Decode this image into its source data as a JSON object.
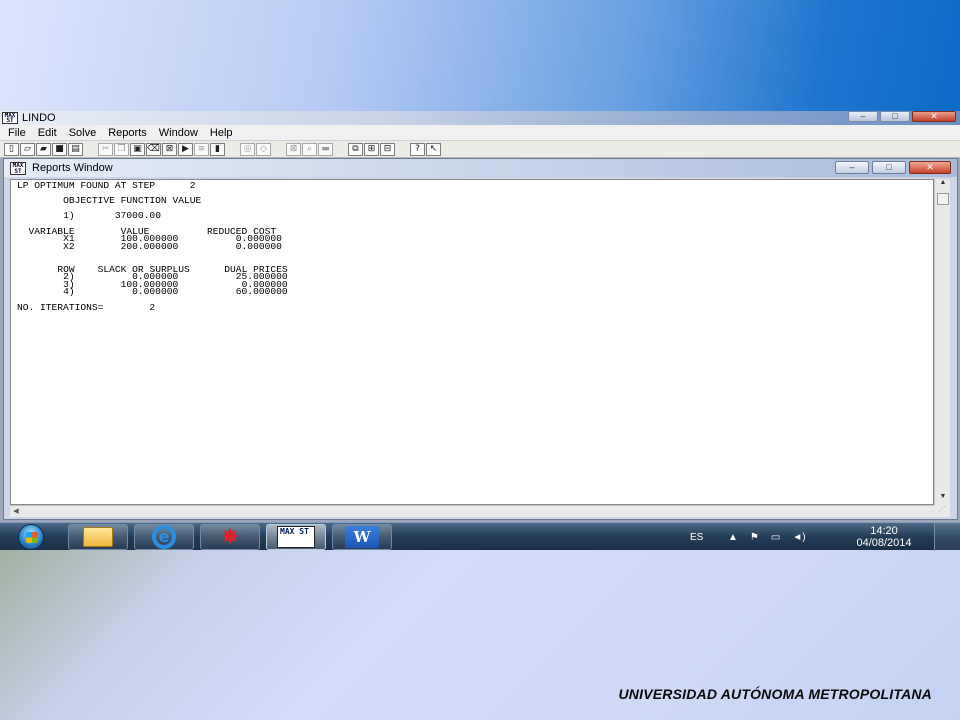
{
  "app": {
    "title": "LINDO",
    "icon_text": "MAX ST",
    "controls": {
      "minimize": "–",
      "maximize": "□",
      "close": "✕"
    }
  },
  "menu": [
    "File",
    "Edit",
    "Solve",
    "Reports",
    "Window",
    "Help"
  ],
  "toolbar": {
    "groups": [
      [
        "new-file-icon",
        "open-file-icon",
        "open-view-icon",
        "save-icon",
        "print-icon"
      ],
      [
        "cut-icon",
        "copy-icon",
        "paste-icon",
        "clear-icon",
        "find-icon",
        "go-to-line-icon",
        "look-icon"
      ],
      [
        "solve-icon",
        "compile-icon"
      ],
      [
        "picture-icon",
        "options-icon",
        "send-to-back-icon"
      ],
      [
        "cascade-icon",
        "tile-icon",
        "close-all-icon"
      ],
      [
        "help-icon",
        "context-help-icon"
      ]
    ]
  },
  "report_window": {
    "title": "Reports Window",
    "controls": {
      "minimize": "–",
      "maximize": "□",
      "close": "✕"
    },
    "report": {
      "header": "LP OPTIMUM FOUND AT STEP      2",
      "objective_label": "OBJECTIVE FUNCTION VALUE",
      "objective_row": "1)",
      "objective_value": "37000.00",
      "var_headers": [
        "VARIABLE",
        "VALUE",
        "REDUCED COST"
      ],
      "variables": [
        {
          "name": "X1",
          "value": "100.000000",
          "reduced_cost": "0.000000"
        },
        {
          "name": "X2",
          "value": "200.000000",
          "reduced_cost": "0.000000"
        }
      ],
      "row_headers": [
        "ROW",
        "SLACK OR SURPLUS",
        "DUAL PRICES"
      ],
      "rows": [
        {
          "row": "2)",
          "slack": "0.000000",
          "dual": "25.000000"
        },
        {
          "row": "3)",
          "slack": "100.000000",
          "dual": "0.000000"
        },
        {
          "row": "4)",
          "slack": "0.000000",
          "dual": "60.000000"
        }
      ],
      "iterations": "NO. ITERATIONS=        2"
    }
  },
  "taskbar": {
    "apps": [
      {
        "name": "Windows Explorer",
        "icon": "folder-icon"
      },
      {
        "name": "Internet Explorer",
        "icon": "ie-icon"
      },
      {
        "name": "Red star app",
        "icon": "star-icon"
      },
      {
        "name": "LINDO",
        "icon": "lindo-icon",
        "active": true,
        "label": "MAX ST"
      },
      {
        "name": "Microsoft Word",
        "icon": "word-icon",
        "label": "W"
      }
    ],
    "language": "ES",
    "time": "14:20",
    "date": "04/08/2014"
  },
  "footer": "UNIVERSIDAD AUTÓNOMA METROPOLITANA"
}
